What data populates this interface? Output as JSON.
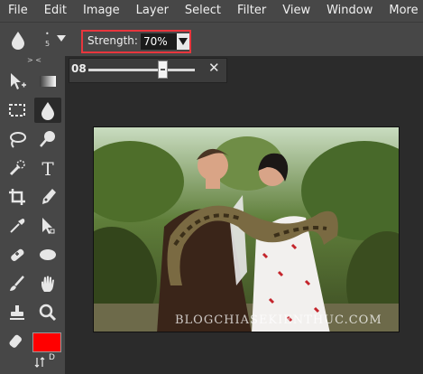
{
  "menubar": {
    "items": [
      "File",
      "Edit",
      "Image",
      "Layer",
      "Select",
      "Filter",
      "View",
      "Window",
      "More"
    ]
  },
  "options": {
    "brush_size_small": "5",
    "strength_label": "Strength:",
    "strength_value": "70%"
  },
  "slider": {
    "value_label": "08",
    "value_fraction": 0.7,
    "close_glyph": "✕"
  },
  "toolbar": {
    "collapse_label": "> <",
    "default_colors_label": "D"
  },
  "canvas": {
    "watermark": "BLOGCHIASEKIENTHUC.COM"
  },
  "colors": {
    "foreground": "#ff0000",
    "highlight_border": "#e8363d"
  }
}
